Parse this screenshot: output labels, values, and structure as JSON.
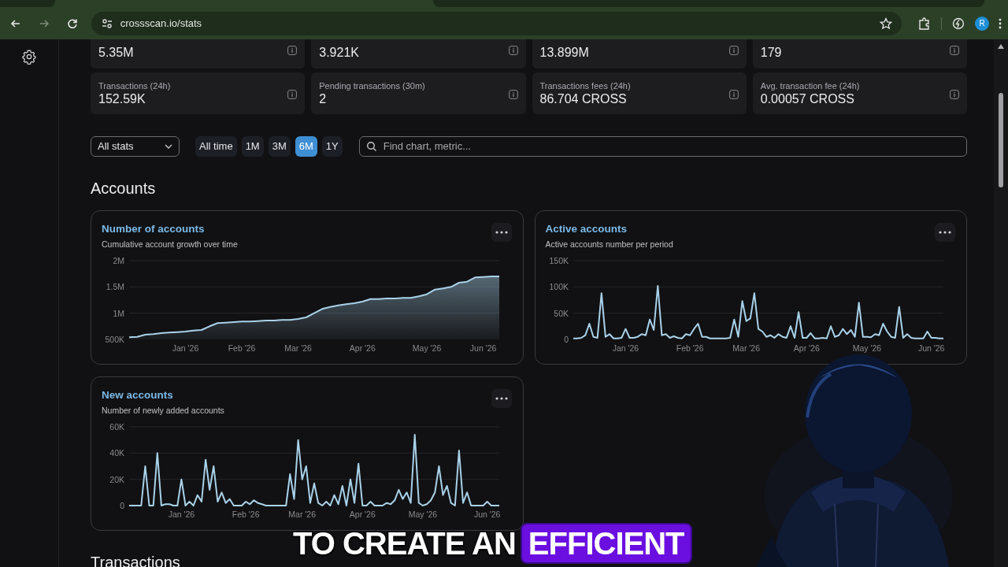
{
  "browser": {
    "url": "crossscan.io/stats",
    "avatar_letter": "R"
  },
  "stats": [
    {
      "value": "5.35M"
    },
    {
      "value": "3.921K"
    },
    {
      "value": "13.899M"
    },
    {
      "value": "179"
    },
    {
      "label": "Transactions (24h)",
      "value": "152.59K"
    },
    {
      "label": "Pending transactions (30m)",
      "value": "2"
    },
    {
      "label": "Transactions fees (24h)",
      "value": "86.704 CROSS"
    },
    {
      "label": "Avg. transaction fee (24h)",
      "value": "0.00057 CROSS"
    }
  ],
  "filters": {
    "dropdown": "All stats",
    "ranges": [
      {
        "label": "All time",
        "selected": false
      },
      {
        "label": "1M",
        "selected": false
      },
      {
        "label": "3M",
        "selected": false
      },
      {
        "label": "6M",
        "selected": true
      },
      {
        "label": "1Y",
        "selected": false
      }
    ],
    "search_placeholder": "Find chart, metric..."
  },
  "sections": [
    {
      "title": "Accounts",
      "charts": [
        {
          "title": "Number of accounts",
          "subtitle": "Cumulative account growth over time",
          "chart_data": {
            "type": "area",
            "categories": [
              null,
              null,
              null,
              null,
              null,
              null,
              null,
              "Jan '26",
              null,
              null,
              null,
              null,
              null,
              null,
              "Feb '26",
              null,
              null,
              null,
              null,
              null,
              null,
              "Mar '26",
              null,
              null,
              null,
              null,
              null,
              null,
              null,
              "Apr '26",
              null,
              null,
              null,
              null,
              null,
              null,
              null,
              "May '26",
              null,
              null,
              null,
              null,
              null,
              null,
              "Jun '26",
              null,
              null
            ],
            "series": [
              {
                "color": "#a9d2ea",
                "values": [
                  540000,
                  550000,
                  590000,
                  600000,
                  620000,
                  630000,
                  640000,
                  650000,
                  670000,
                  680000,
                  750000,
                  810000,
                  820000,
                  830000,
                  840000,
                  840000,
                  850000,
                  860000,
                  860000,
                  870000,
                  870000,
                  890000,
                  920000,
                  1000000,
                  1080000,
                  1120000,
                  1150000,
                  1170000,
                  1190000,
                  1220000,
                  1270000,
                  1270000,
                  1280000,
                  1280000,
                  1290000,
                  1290000,
                  1320000,
                  1360000,
                  1450000,
                  1470000,
                  1500000,
                  1580000,
                  1600000,
                  1680000,
                  1690000,
                  1700000,
                  1700000
                ]
              }
            ],
            "ylim": [
              500000,
              2000000
            ],
            "yticks": [
              {
                "value": 500000,
                "label": "500K"
              },
              {
                "value": 1000000,
                "label": "1M"
              },
              {
                "value": 1500000,
                "label": "1.5M"
              },
              {
                "value": 2000000,
                "label": "2M"
              }
            ]
          }
        },
        {
          "title": "Active accounts",
          "subtitle": "Active accounts number per period",
          "chart_data": {
            "type": "line",
            "categories": [
              null,
              null,
              null,
              null,
              null,
              null,
              null,
              null,
              null,
              null,
              null,
              null,
              null,
              "Jan '26",
              null,
              null,
              null,
              null,
              null,
              null,
              null,
              null,
              null,
              null,
              null,
              null,
              null,
              null,
              null,
              "Feb '26",
              null,
              null,
              null,
              null,
              null,
              null,
              null,
              null,
              null,
              null,
              null,
              null,
              null,
              "Mar '26",
              null,
              null,
              null,
              null,
              null,
              null,
              null,
              null,
              null,
              null,
              null,
              null,
              null,
              null,
              "Apr '26",
              null,
              null,
              null,
              null,
              null,
              null,
              null,
              null,
              null,
              null,
              null,
              null,
              null,
              null,
              "May '26",
              null,
              null,
              null,
              null,
              null,
              null,
              null,
              null,
              null,
              null,
              null,
              null,
              null,
              null,
              null,
              "Jun '26",
              null,
              null,
              null
            ],
            "series": [
              {
                "color": "#a9d2ea",
                "values": [
                  2,
                  2,
                  3,
                  8,
                  30,
                  5,
                  3,
                  88,
                  5,
                  10,
                  2,
                  2,
                  3,
                  20,
                  3,
                  3,
                  5,
                  10,
                  8,
                  38,
                  18,
                  102,
                  8,
                  10,
                  3,
                  6,
                  3,
                  2,
                  10,
                  8,
                  20,
                  30,
                  5,
                  5,
                  2,
                  2,
                  2,
                  2,
                  2,
                  3,
                  38,
                  5,
                  73,
                  35,
                  40,
                  88,
                  20,
                  15,
                  5,
                  8,
                  3,
                  10,
                  5,
                  3,
                  25,
                  3,
                  52,
                  3,
                  3,
                  12,
                  2,
                  2,
                  3,
                  2,
                  25,
                  5,
                  8,
                  20,
                  10,
                  18,
                  5,
                  70,
                  5,
                  5,
                  4,
                  10,
                  8,
                  30,
                  15,
                  5,
                  3,
                  62,
                  3,
                  10,
                  3,
                  2,
                  2,
                  2,
                  15,
                  3,
                  3,
                  2,
                  2
                ]
              }
            ],
            "ylim": [
              0,
              150
            ],
            "yticks": [
              {
                "value": 0,
                "label": "0"
              },
              {
                "value": 50,
                "label": "50K"
              },
              {
                "value": 100,
                "label": "100K"
              },
              {
                "value": 150,
                "label": "150K"
              }
            ]
          }
        },
        {
          "title": "New accounts",
          "subtitle": "Number of newly added accounts",
          "chart_data": {
            "type": "line",
            "categories": [
              null,
              null,
              null,
              null,
              null,
              null,
              null,
              null,
              null,
              null,
              null,
              null,
              null,
              "Jan '26",
              null,
              null,
              null,
              null,
              null,
              null,
              null,
              null,
              null,
              null,
              null,
              null,
              null,
              null,
              null,
              "Feb '26",
              null,
              null,
              null,
              null,
              null,
              null,
              null,
              null,
              null,
              null,
              null,
              null,
              null,
              "Mar '26",
              null,
              null,
              null,
              null,
              null,
              null,
              null,
              null,
              null,
              null,
              null,
              null,
              null,
              null,
              "Apr '26",
              null,
              null,
              null,
              null,
              null,
              null,
              null,
              null,
              null,
              null,
              null,
              null,
              null,
              null,
              "May '26",
              null,
              null,
              null,
              null,
              null,
              null,
              null,
              null,
              null,
              null,
              null,
              null,
              null,
              null,
              null,
              "Jun '26",
              null,
              null,
              null
            ],
            "series": [
              {
                "color": "#a9d2ea",
                "values": [
                  0,
                  0,
                  0,
                  0,
                  30,
                  0,
                  0,
                  40,
                  0,
                  1,
                  1,
                  0,
                  0,
                  20,
                  0,
                  3,
                  0,
                  8,
                  3,
                  35,
                  12,
                  30,
                  3,
                  10,
                  2,
                  5,
                  0,
                  0,
                  0,
                  3,
                  1,
                  4,
                  2,
                  1,
                  0,
                  0,
                  0,
                  0,
                  0,
                  0,
                  24,
                  5,
                  50,
                  20,
                  30,
                  2,
                  17,
                  2,
                  0,
                  3,
                  0,
                  8,
                  1,
                  15,
                  0,
                  20,
                  2,
                  32,
                  0,
                  0,
                  3,
                  0,
                  0,
                  0,
                  2,
                  1,
                  4,
                  12,
                  5,
                  10,
                  2,
                  54,
                  2,
                  0,
                  1,
                  4,
                  10,
                  30,
                  8,
                  15,
                  2,
                  0,
                  42,
                  2,
                  10,
                  0,
                  0,
                  0,
                  0,
                  3,
                  0,
                  0,
                  0
                ]
              }
            ],
            "ylim": [
              0,
              60
            ],
            "yticks": [
              {
                "value": 0,
                "label": "0"
              },
              {
                "value": 20,
                "label": "20K"
              },
              {
                "value": 40,
                "label": "40K"
              },
              {
                "value": 60,
                "label": "60K"
              }
            ]
          }
        }
      ]
    },
    {
      "title": "Transactions"
    }
  ],
  "caption": [
    {
      "text": "TO CREATE AN",
      "highlighted": false
    },
    {
      "text": "EFFICIENT",
      "highlighted": true
    }
  ]
}
